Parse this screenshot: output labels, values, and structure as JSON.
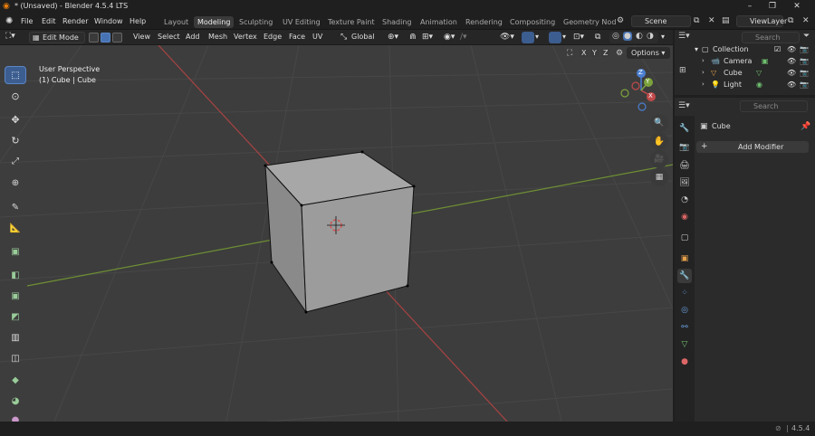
{
  "title": "* (Unsaved) - Blender 4.5.4 LTS",
  "menus": [
    "File",
    "Edit",
    "Render",
    "Window",
    "Help"
  ],
  "workspaces": [
    "Layout",
    "Modeling",
    "Sculpting",
    "UV Editing",
    "Texture Paint",
    "Shading",
    "Animation",
    "Rendering",
    "Compositing",
    "Geometry Nod"
  ],
  "active_workspace": "Modeling",
  "scene": "Scene",
  "view_layer": "ViewLayer",
  "viewport": {
    "mode": "Edit Mode",
    "menu": [
      "View",
      "Select",
      "Add",
      "Mesh",
      "Vertex",
      "Edge",
      "Face",
      "UV"
    ],
    "transform_orientation": "Global",
    "options": "Options",
    "info_line1": "User Perspective",
    "info_line2": "(1) Cube | Cube",
    "gizmo": {
      "x": "X",
      "y": "Y",
      "z": "Z"
    },
    "axis_buttons": [
      "X",
      "Y",
      "Z"
    ]
  },
  "outliner": {
    "search_placeholder": "Search",
    "collection": "Collection",
    "items": [
      "Camera",
      "Cube",
      "Light"
    ]
  },
  "properties": {
    "search_placeholder": "Search",
    "object_name": "Cube",
    "add_modifier": "Add Modifier"
  },
  "status": {
    "version": "4.5.4"
  },
  "colors": {
    "accent": "#4772b3",
    "x_axis": "#c14a4a",
    "y_axis": "#7ca33b",
    "z_axis": "#4b7fd1"
  }
}
